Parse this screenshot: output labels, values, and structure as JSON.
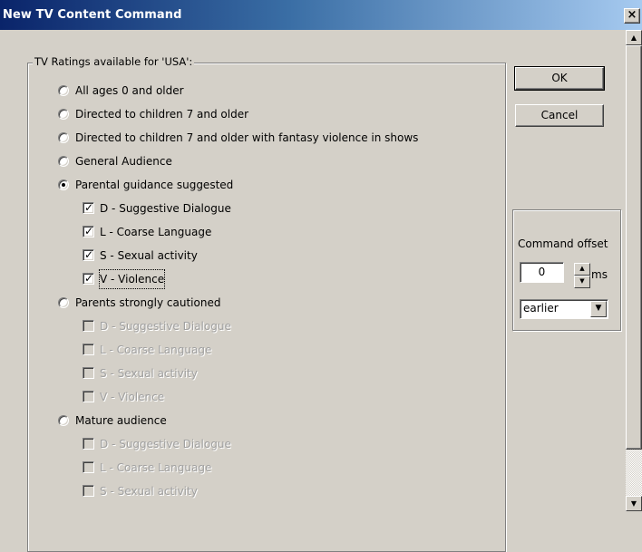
{
  "window": {
    "title": "New TV Content Command",
    "close_label": "×"
  },
  "ratings_group": {
    "legend": "TV Ratings available for 'USA':"
  },
  "ratings": [
    {
      "label": "All ages 0 and older",
      "checked": false
    },
    {
      "label": "Directed to children 7 and older",
      "checked": false
    },
    {
      "label": "Directed to children 7 and older with fantasy violence in shows",
      "checked": false
    },
    {
      "label": "General Audience",
      "checked": false
    },
    {
      "label": "Parental guidance suggested",
      "checked": true,
      "subs": [
        {
          "label": "D - Suggestive Dialogue",
          "checked": true,
          "enabled": true
        },
        {
          "label": "L - Coarse Language",
          "checked": true,
          "enabled": true
        },
        {
          "label": "S - Sexual activity",
          "checked": true,
          "enabled": true
        },
        {
          "label": "V - Violence",
          "checked": true,
          "enabled": true,
          "focused": true
        }
      ]
    },
    {
      "label": "Parents strongly cautioned",
      "checked": false,
      "subs": [
        {
          "label": "D - Suggestive Dialogue",
          "checked": false,
          "enabled": false
        },
        {
          "label": "L - Coarse Language",
          "checked": false,
          "enabled": false
        },
        {
          "label": "S - Sexual activity",
          "checked": false,
          "enabled": false
        },
        {
          "label": "V - Violence",
          "checked": false,
          "enabled": false
        }
      ]
    },
    {
      "label": "Mature audience",
      "checked": false,
      "subs": [
        {
          "label": "D - Suggestive Dialogue",
          "checked": false,
          "enabled": false
        },
        {
          "label": "L - Coarse Language",
          "checked": false,
          "enabled": false
        },
        {
          "label": "S - Sexual activity",
          "checked": false,
          "enabled": false
        }
      ]
    }
  ],
  "buttons": {
    "ok": "OK",
    "cancel": "Cancel"
  },
  "command_offset": {
    "legend": "Command offset",
    "value": "0",
    "unit": "ms",
    "direction": "earlier",
    "spin_up_icon": "▲",
    "spin_down_icon": "▼",
    "dropdown_icon": "▼"
  },
  "scrollbar": {
    "up_icon": "▲",
    "down_icon": "▼"
  }
}
